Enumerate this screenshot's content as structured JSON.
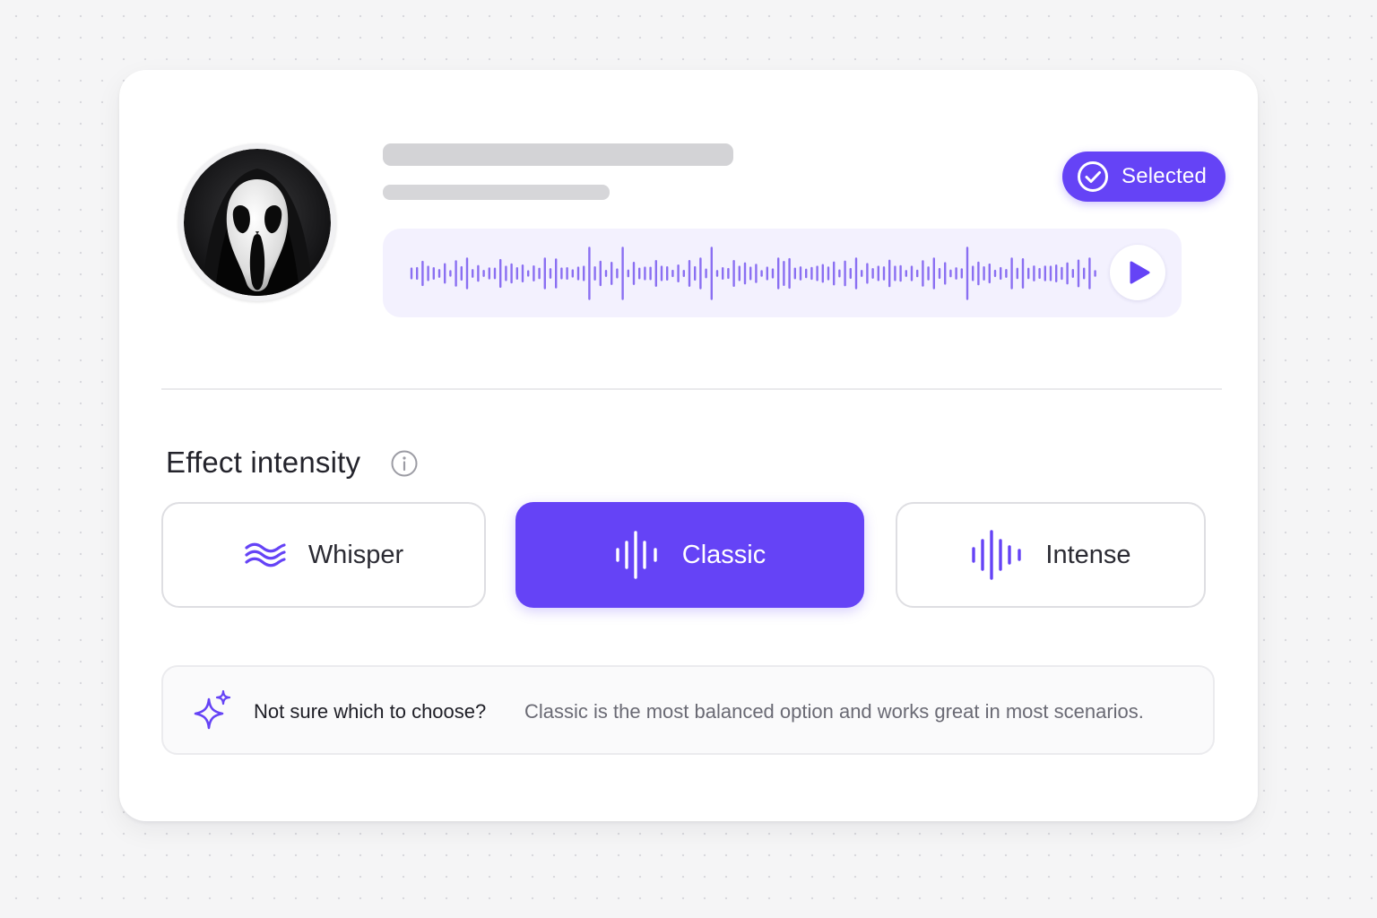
{
  "voice_card": {
    "avatar_icon": "ghostface-mask-avatar",
    "status_badge": {
      "label": "Selected",
      "icon": "check-circle-icon"
    },
    "audio_preview": {
      "play_icon": "play-icon"
    }
  },
  "effect_intensity": {
    "title": "Effect intensity",
    "info_icon": "info-icon",
    "options": [
      {
        "label": "Whisper",
        "icon": "wave-lines-icon",
        "selected": false
      },
      {
        "label": "Classic",
        "icon": "soundwave-icon",
        "selected": true
      },
      {
        "label": "Intense",
        "icon": "soundwave-icon",
        "selected": false
      }
    ]
  },
  "tip": {
    "icon": "sparkle-icon",
    "question": "Not sure which to choose?",
    "text": "Classic is the most balanced option and works great in most scenarios."
  },
  "colors": {
    "accent": "#6543f6",
    "waveform": "#8a6ff2",
    "card": "#ffffff",
    "background": "#f5f5f6"
  }
}
